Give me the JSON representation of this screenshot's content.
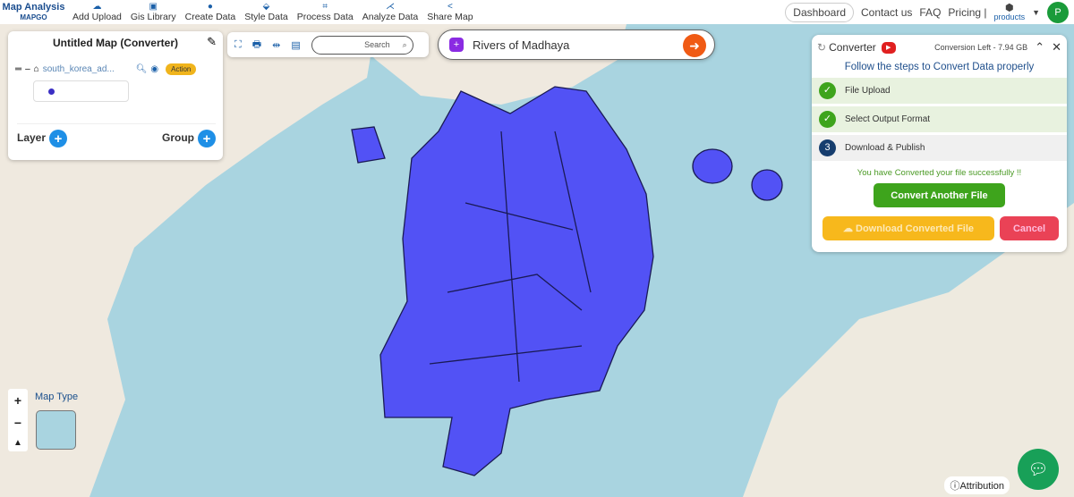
{
  "header": {
    "logo_title": "Map Analysis",
    "logo_sub": "MAPGO",
    "nav": [
      {
        "label": "Add Upload",
        "icon": "cloud-upload-icon"
      },
      {
        "label": "Gis Library",
        "icon": "library-icon"
      },
      {
        "label": "Create Data",
        "icon": "pin-icon"
      },
      {
        "label": "Style Data",
        "icon": "style-icon"
      },
      {
        "label": "Process Data",
        "icon": "process-icon"
      },
      {
        "label": "Analyze Data",
        "icon": "analyze-icon"
      },
      {
        "label": "Share Map",
        "icon": "share-icon"
      }
    ],
    "dashboard": "Dashboard",
    "contact": "Contact us",
    "faq": "FAQ",
    "pricing": "Pricing |",
    "products": "products",
    "avatar": "P"
  },
  "layers_panel": {
    "title": "Untitled Map (Converter)",
    "layer_name": "south_korea_ad...",
    "action": "Action",
    "layer_label": "Layer",
    "group_label": "Group"
  },
  "toolbar": {
    "search_placeholder": "Search"
  },
  "prompt": {
    "text": "Rivers of Madhaya"
  },
  "converter": {
    "title": "Converter",
    "conversion_left": "Conversion Left - 7.94 GB",
    "subtitle": "Follow the steps to Convert Data properly",
    "steps": [
      {
        "label": "File Upload",
        "status": "done"
      },
      {
        "label": "Select Output Format",
        "status": "done"
      },
      {
        "label": "Download & Publish",
        "status": "current",
        "num": "3"
      }
    ],
    "success": "You have Converted your file successfully !!",
    "convert_another": "Convert Another File",
    "download": "Download Converted File",
    "cancel": "Cancel"
  },
  "map": {
    "map_type": "Map Type",
    "attribution": "Attribution",
    "polygon_color": "#5252f5"
  }
}
